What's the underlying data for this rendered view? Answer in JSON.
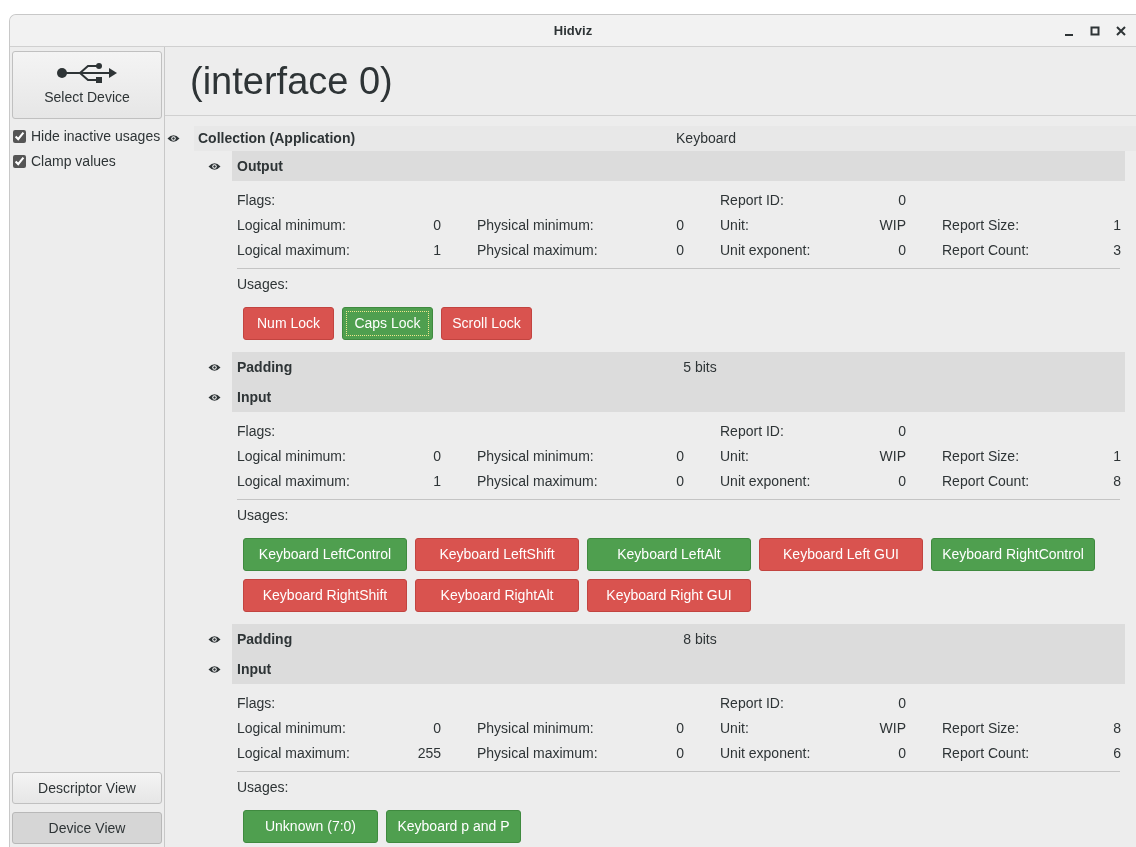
{
  "window": {
    "title": "Hidviz"
  },
  "sidebar": {
    "select_device": {
      "label": "Select Device"
    },
    "options": [
      {
        "label": "Hide inactive usages",
        "checked": true
      },
      {
        "label": "Clamp values",
        "checked": true
      }
    ],
    "views": [
      {
        "label": "Descriptor View",
        "selected": false
      },
      {
        "label": "Device View",
        "selected": true
      }
    ]
  },
  "heading": "(interface 0)",
  "collection": {
    "label": "Collection (Application)",
    "value": "Keyboard",
    "items": [
      {
        "kind": "field",
        "title": "Output",
        "stats": {
          "flags": {
            "label": "Flags:"
          },
          "report_id": {
            "label": "Report ID:",
            "value": "0"
          },
          "logical_minimum": {
            "label": "Logical minimum:",
            "value": "0"
          },
          "physical_minimum": {
            "label": "Physical minimum:",
            "value": "0"
          },
          "unit": {
            "label": "Unit:",
            "value": "WIP"
          },
          "report_size": {
            "label": "Report Size:",
            "value": "1"
          },
          "logical_maximum": {
            "label": "Logical maximum:",
            "value": "1"
          },
          "physical_maximum": {
            "label": "Physical maximum:",
            "value": "0"
          },
          "unit_exponent": {
            "label": "Unit exponent:",
            "value": "0"
          },
          "report_count": {
            "label": "Report Count:",
            "value": "3"
          }
        },
        "usages_label": "Usages:",
        "usages": [
          {
            "label": "Num Lock",
            "active": false,
            "focused": false
          },
          {
            "label": "Caps Lock",
            "active": true,
            "focused": true
          },
          {
            "label": "Scroll Lock",
            "active": false,
            "focused": false
          }
        ]
      },
      {
        "kind": "padding",
        "title": "Padding",
        "value": "5 bits"
      },
      {
        "kind": "field",
        "title": "Input",
        "stats": {
          "flags": {
            "label": "Flags:"
          },
          "report_id": {
            "label": "Report ID:",
            "value": "0"
          },
          "logical_minimum": {
            "label": "Logical minimum:",
            "value": "0"
          },
          "physical_minimum": {
            "label": "Physical minimum:",
            "value": "0"
          },
          "unit": {
            "label": "Unit:",
            "value": "WIP"
          },
          "report_size": {
            "label": "Report Size:",
            "value": "1"
          },
          "logical_maximum": {
            "label": "Logical maximum:",
            "value": "1"
          },
          "physical_maximum": {
            "label": "Physical maximum:",
            "value": "0"
          },
          "unit_exponent": {
            "label": "Unit exponent:",
            "value": "0"
          },
          "report_count": {
            "label": "Report Count:",
            "value": "8"
          }
        },
        "usages_label": "Usages:",
        "usages": [
          {
            "label": "Keyboard LeftControl",
            "active": true,
            "focused": false
          },
          {
            "label": "Keyboard LeftShift",
            "active": false,
            "focused": false
          },
          {
            "label": "Keyboard LeftAlt",
            "active": true,
            "focused": false
          },
          {
            "label": "Keyboard Left GUI",
            "active": false,
            "focused": false
          },
          {
            "label": "Keyboard RightControl",
            "active": true,
            "focused": false
          },
          {
            "label": "Keyboard RightShift",
            "active": false,
            "focused": false
          },
          {
            "label": "Keyboard RightAlt",
            "active": false,
            "focused": false
          },
          {
            "label": "Keyboard Right GUI",
            "active": false,
            "focused": false
          }
        ]
      },
      {
        "kind": "padding",
        "title": "Padding",
        "value": "8 bits"
      },
      {
        "kind": "field",
        "title": "Input",
        "stats": {
          "flags": {
            "label": "Flags:"
          },
          "report_id": {
            "label": "Report ID:",
            "value": "0"
          },
          "logical_minimum": {
            "label": "Logical minimum:",
            "value": "0"
          },
          "physical_minimum": {
            "label": "Physical minimum:",
            "value": "0"
          },
          "unit": {
            "label": "Unit:",
            "value": "WIP"
          },
          "report_size": {
            "label": "Report Size:",
            "value": "8"
          },
          "logical_maximum": {
            "label": "Logical maximum:",
            "value": "255"
          },
          "physical_maximum": {
            "label": "Physical maximum:",
            "value": "0"
          },
          "unit_exponent": {
            "label": "Unit exponent:",
            "value": "0"
          },
          "report_count": {
            "label": "Report Count:",
            "value": "6"
          }
        },
        "usages_label": "Usages:",
        "usages": [
          {
            "label": "Unknown (7:0)",
            "active": true,
            "focused": false
          },
          {
            "label": "Keyboard p and P",
            "active": true,
            "focused": false
          }
        ]
      }
    ]
  }
}
